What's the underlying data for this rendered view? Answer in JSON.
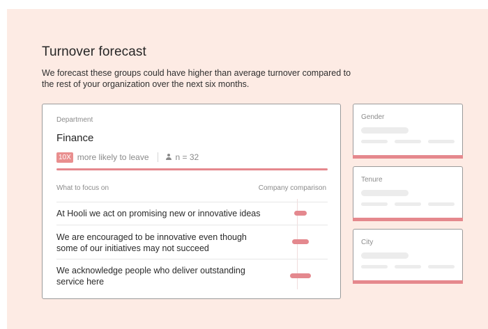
{
  "header": {
    "title": "Turnover forecast",
    "subtitle": "We forecast these groups could have higher than average turnover compared to the rest of your organization over the next six months."
  },
  "main_card": {
    "category_label": "Department",
    "group_name": "Finance",
    "risk_badge": "10X",
    "risk_text": "more likely to leave",
    "count_text": "n = 32",
    "focus_header": "What to focus on",
    "comparison_header": "Company comparison",
    "focus_items": [
      {
        "text": "At Hooli we act on promising new or innovative ideas",
        "comparison_level": 0.45
      },
      {
        "text": "We are encouraged to be innovative even though some of our initiatives may not succeed",
        "comparison_level": 0.6
      },
      {
        "text": "We acknowledge people who deliver outstanding service here",
        "comparison_level": 0.75
      }
    ],
    "icons": {
      "count": "person-icon"
    }
  },
  "side_cards": [
    {
      "label": "Gender"
    },
    {
      "label": "Tenure"
    },
    {
      "label": "City"
    }
  ],
  "colors": {
    "background": "#fdebe4",
    "accent": "#e5888d",
    "badge": "#e98f8f",
    "card_border": "#9a9a9a"
  }
}
